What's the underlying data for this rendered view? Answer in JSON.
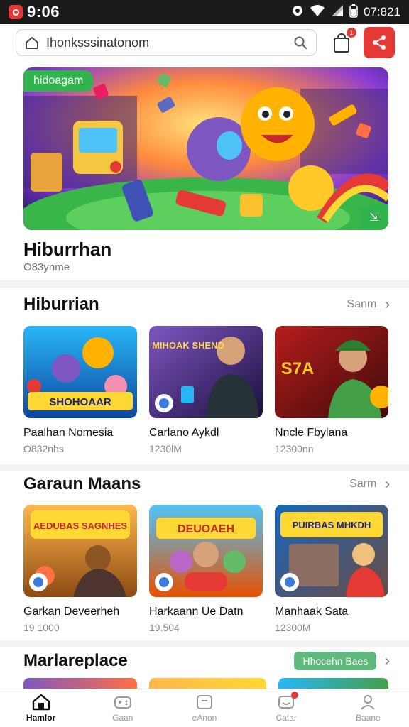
{
  "status_bar": {
    "time": "9:06",
    "right_text": "07:821",
    "icons": [
      "app-icon",
      "alarm-icon",
      "wifi-icon",
      "signal-icon",
      "battery-icon"
    ]
  },
  "search": {
    "placeholder": "Ihonksssinatonom",
    "icons": [
      "home-icon",
      "search-icon"
    ]
  },
  "cart_badge": "1",
  "hero": {
    "tag": "hidoagam",
    "title": "Hiburrhan",
    "subtitle": "O83ynme"
  },
  "sections": [
    {
      "title": "Hiburrian",
      "more_label": "Sanm",
      "cards": [
        {
          "name": "Paalhan Nomesia",
          "meta": "O832nhs",
          "art": "SHOHOAAR"
        },
        {
          "name": "Carlano Aykdl",
          "meta": "1230lM",
          "art": "MIHOAK SHEND"
        },
        {
          "name": "Nncle Fbylana",
          "meta": "12300nn",
          "art": "S7A"
        }
      ]
    },
    {
      "title": "Garaun Maans",
      "more_label": "Sarm",
      "cards": [
        {
          "name": "Garkan Deveerheh",
          "meta": "19 1000",
          "art": "AEDUBAS SAGNHES"
        },
        {
          "name": "Harkaann Ue Datn",
          "meta": "19.504",
          "art": "DEUOAEH"
        },
        {
          "name": "Manhaak Sata",
          "meta": "12300M",
          "art": "PUIRBAS MHKDH"
        }
      ]
    }
  ],
  "marketplace": {
    "title": "Marlareplace",
    "pill_label": "Hhocehn Baes"
  },
  "bottom_nav": [
    {
      "label": "Hamlor",
      "icon": "home-icon",
      "active": true
    },
    {
      "label": "Gaan",
      "icon": "gamepad-icon",
      "active": false
    },
    {
      "label": "eAnon",
      "icon": "tv-icon",
      "active": false
    },
    {
      "label": "Catar",
      "icon": "chat-icon",
      "active": false
    },
    {
      "label": "Baane",
      "icon": "profile-icon",
      "active": false
    }
  ],
  "colors": {
    "accent_red": "#e53935",
    "accent_green": "#31b34d",
    "status_bar": "#1b1b1b"
  }
}
